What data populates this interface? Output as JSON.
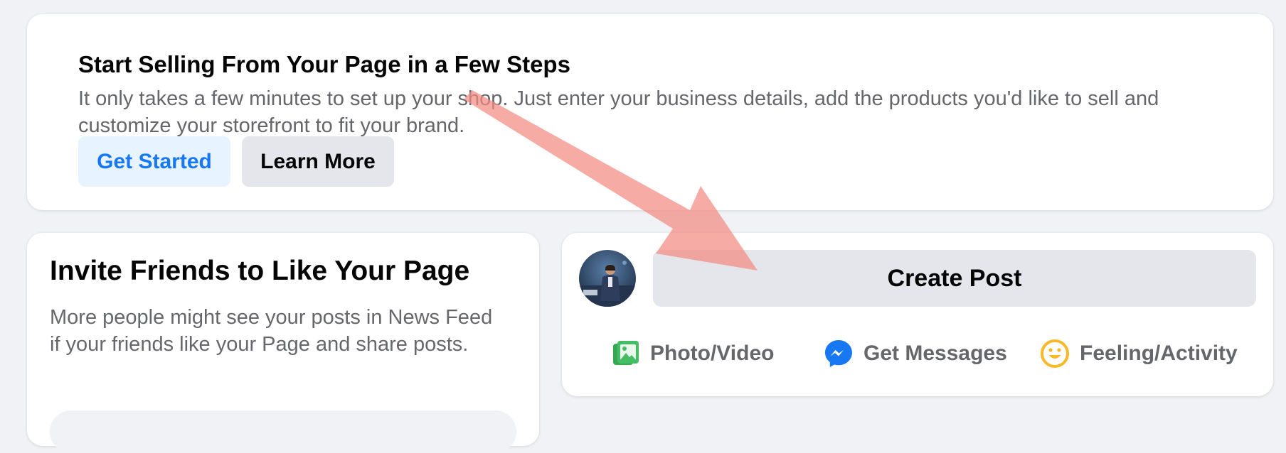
{
  "shop_card": {
    "title": "Start Selling From Your Page in a Few Steps",
    "description": "It only takes a few minutes to set up your shop. Just enter your business details, add the products you'd like to sell and customize your storefront to fit your brand.",
    "get_started_label": "Get Started",
    "learn_more_label": "Learn More"
  },
  "invite_card": {
    "title": "Invite Friends to Like Your Page",
    "description": "More people might see your posts in News Feed if your friends like your Page and share posts."
  },
  "post_card": {
    "create_post_label": "Create Post",
    "actions": [
      {
        "label": "Photo/Video",
        "icon": "photo-video-icon"
      },
      {
        "label": "Get Messages",
        "icon": "messenger-icon"
      },
      {
        "label": "Feeling/Activity",
        "icon": "smiley-icon"
      }
    ]
  },
  "colors": {
    "background": "#f0f2f5",
    "accent_blue": "#1877f2",
    "photo_green": "#45bd62",
    "feeling_yellow": "#f7b928",
    "arrow_red": "#f28b82"
  }
}
